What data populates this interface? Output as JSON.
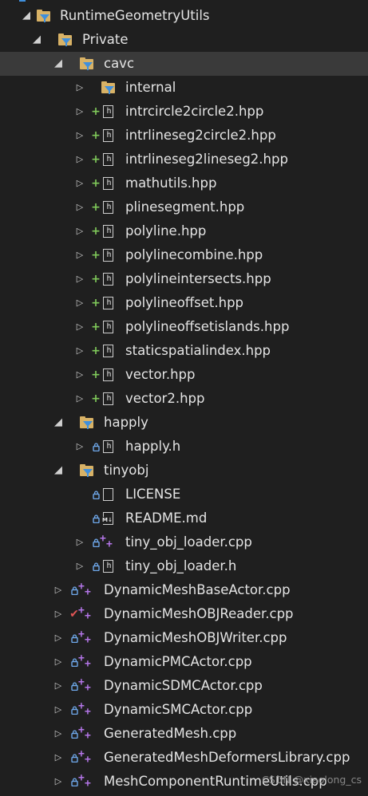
{
  "tree": [
    {
      "label": "RuntimeGeometryUtils",
      "kind": "folder",
      "expanded": true,
      "state": "",
      "level": 0
    },
    {
      "label": "Private",
      "kind": "folder",
      "expanded": true,
      "state": "",
      "level": 1
    },
    {
      "label": "cavc",
      "kind": "folder",
      "expanded": true,
      "state": "",
      "level": 2,
      "selected": true
    },
    {
      "label": "internal",
      "kind": "folder",
      "expanded": false,
      "state": "",
      "level": 3
    },
    {
      "label": "intrcircle2circle2.hpp",
      "kind": "header",
      "expanded": false,
      "state": "plus",
      "level": 3
    },
    {
      "label": "intrlineseg2circle2.hpp",
      "kind": "header",
      "expanded": false,
      "state": "plus",
      "level": 3
    },
    {
      "label": "intrlineseg2lineseg2.hpp",
      "kind": "header",
      "expanded": false,
      "state": "plus",
      "level": 3
    },
    {
      "label": "mathutils.hpp",
      "kind": "header",
      "expanded": false,
      "state": "plus",
      "level": 3
    },
    {
      "label": "plinesegment.hpp",
      "kind": "header",
      "expanded": false,
      "state": "plus",
      "level": 3
    },
    {
      "label": "polyline.hpp",
      "kind": "header",
      "expanded": false,
      "state": "plus",
      "level": 3
    },
    {
      "label": "polylinecombine.hpp",
      "kind": "header",
      "expanded": false,
      "state": "plus",
      "level": 3
    },
    {
      "label": "polylineintersects.hpp",
      "kind": "header",
      "expanded": false,
      "state": "plus",
      "level": 3
    },
    {
      "label": "polylineoffset.hpp",
      "kind": "header",
      "expanded": false,
      "state": "plus",
      "level": 3
    },
    {
      "label": "polylineoffsetislands.hpp",
      "kind": "header",
      "expanded": false,
      "state": "plus",
      "level": 3
    },
    {
      "label": "staticspatialindex.hpp",
      "kind": "header",
      "expanded": false,
      "state": "plus",
      "level": 3
    },
    {
      "label": "vector.hpp",
      "kind": "header",
      "expanded": false,
      "state": "plus",
      "level": 3
    },
    {
      "label": "vector2.hpp",
      "kind": "header",
      "expanded": false,
      "state": "plus",
      "level": 3
    },
    {
      "label": "happly",
      "kind": "folder",
      "expanded": true,
      "state": "",
      "level": 2
    },
    {
      "label": "happly.h",
      "kind": "header",
      "expanded": false,
      "state": "lock",
      "level": 3
    },
    {
      "label": "tinyobj",
      "kind": "folder",
      "expanded": true,
      "state": "",
      "level": 2
    },
    {
      "label": "LICENSE",
      "kind": "file",
      "expanded": null,
      "state": "lock",
      "level": 3
    },
    {
      "label": "README.md",
      "kind": "md",
      "expanded": null,
      "state": "lock",
      "level": 3
    },
    {
      "label": "tiny_obj_loader.cpp",
      "kind": "cpp",
      "expanded": false,
      "state": "lock",
      "level": 3
    },
    {
      "label": "tiny_obj_loader.h",
      "kind": "header",
      "expanded": false,
      "state": "lock",
      "level": 3
    },
    {
      "label": "DynamicMeshBaseActor.cpp",
      "kind": "cpp",
      "expanded": false,
      "state": "lock",
      "level": 2
    },
    {
      "label": "DynamicMeshOBJReader.cpp",
      "kind": "cpp",
      "expanded": false,
      "state": "check",
      "level": 2
    },
    {
      "label": "DynamicMeshOBJWriter.cpp",
      "kind": "cpp",
      "expanded": false,
      "state": "lock",
      "level": 2
    },
    {
      "label": "DynamicPMCActor.cpp",
      "kind": "cpp",
      "expanded": false,
      "state": "lock",
      "level": 2
    },
    {
      "label": "DynamicSDMCActor.cpp",
      "kind": "cpp",
      "expanded": false,
      "state": "lock",
      "level": 2
    },
    {
      "label": "DynamicSMCActor.cpp",
      "kind": "cpp",
      "expanded": false,
      "state": "lock",
      "level": 2
    },
    {
      "label": "GeneratedMesh.cpp",
      "kind": "cpp",
      "expanded": false,
      "state": "lock",
      "level": 2
    },
    {
      "label": "GeneratedMeshDeformersLibrary.cpp",
      "kind": "cpp",
      "expanded": false,
      "state": "lock",
      "level": 2
    },
    {
      "label": "MeshComponentRuntimeUtils.cpp",
      "kind": "cpp",
      "expanded": false,
      "state": "lock",
      "level": 2
    }
  ],
  "watermark": "CSDN @xiaolong_cs",
  "colors": {
    "background": "#1f1f1f",
    "selected_row": "#3a3a3a",
    "folder": "#d8b266",
    "filter_funnel": "#3f8fdc",
    "plus_state": "#7fc95a",
    "lock_state": "#6fa8ea",
    "check_state": "#e05555",
    "cpp_icon": "#b476e8"
  }
}
